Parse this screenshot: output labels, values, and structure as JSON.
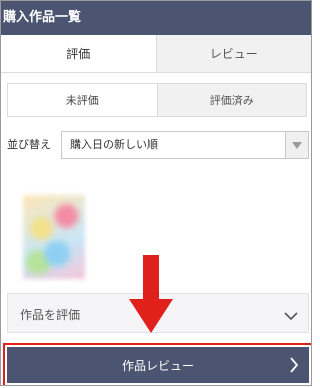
{
  "header": {
    "title": "購入作品一覧"
  },
  "main_tabs": [
    {
      "label": "評価"
    },
    {
      "label": "レビュー"
    }
  ],
  "sub_tabs": [
    {
      "label": "未評価"
    },
    {
      "label": "評価済み"
    }
  ],
  "sort": {
    "label": "並び替え",
    "selected": "購入日の新しい順"
  },
  "rate": {
    "label": "作品を評価"
  },
  "review_button": {
    "label": "作品レビュー"
  },
  "colors": {
    "header_bg": "#4b5470",
    "highlight": "#e0201a"
  }
}
